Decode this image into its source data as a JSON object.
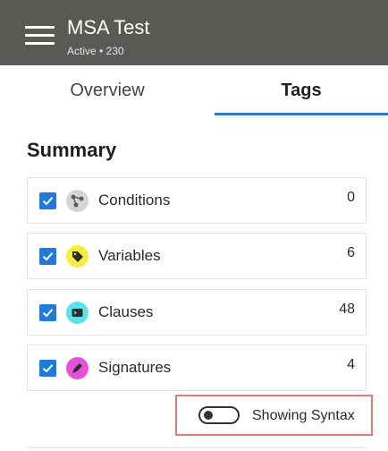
{
  "header": {
    "title": "MSA Test",
    "subtitle": "Active • 230",
    "menu_icon": "hamburger-menu-icon"
  },
  "tabs": [
    {
      "label": "Overview",
      "selected": false
    },
    {
      "label": "Tags",
      "selected": true
    }
  ],
  "summary": {
    "heading": "Summary",
    "items": [
      {
        "label": "Conditions",
        "count": "0",
        "checked": true,
        "icon": "conditions-icon",
        "icon_color": "#d4d4d4"
      },
      {
        "label": "Variables",
        "count": "6",
        "checked": true,
        "icon": "variables-icon",
        "icon_color": "#f5ee3f"
      },
      {
        "label": "Clauses",
        "count": "48",
        "checked": true,
        "icon": "clauses-icon",
        "icon_color": "#5ce1ea"
      },
      {
        "label": "Signatures",
        "count": "4",
        "checked": true,
        "icon": "signatures-icon",
        "icon_color": "#e651d8"
      }
    ]
  },
  "syntax_toggle": {
    "label": "Showing Syntax",
    "on": false,
    "highlight_color": "#e07a75"
  },
  "colors": {
    "header_bg": "#5b5955",
    "accent": "#2b78d0",
    "checkbox": "#1f7ad9"
  }
}
